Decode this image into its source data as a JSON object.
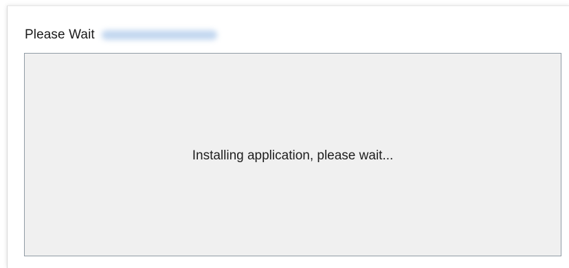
{
  "dialog": {
    "title": "Please Wait",
    "message": "Installing application, please wait..."
  }
}
